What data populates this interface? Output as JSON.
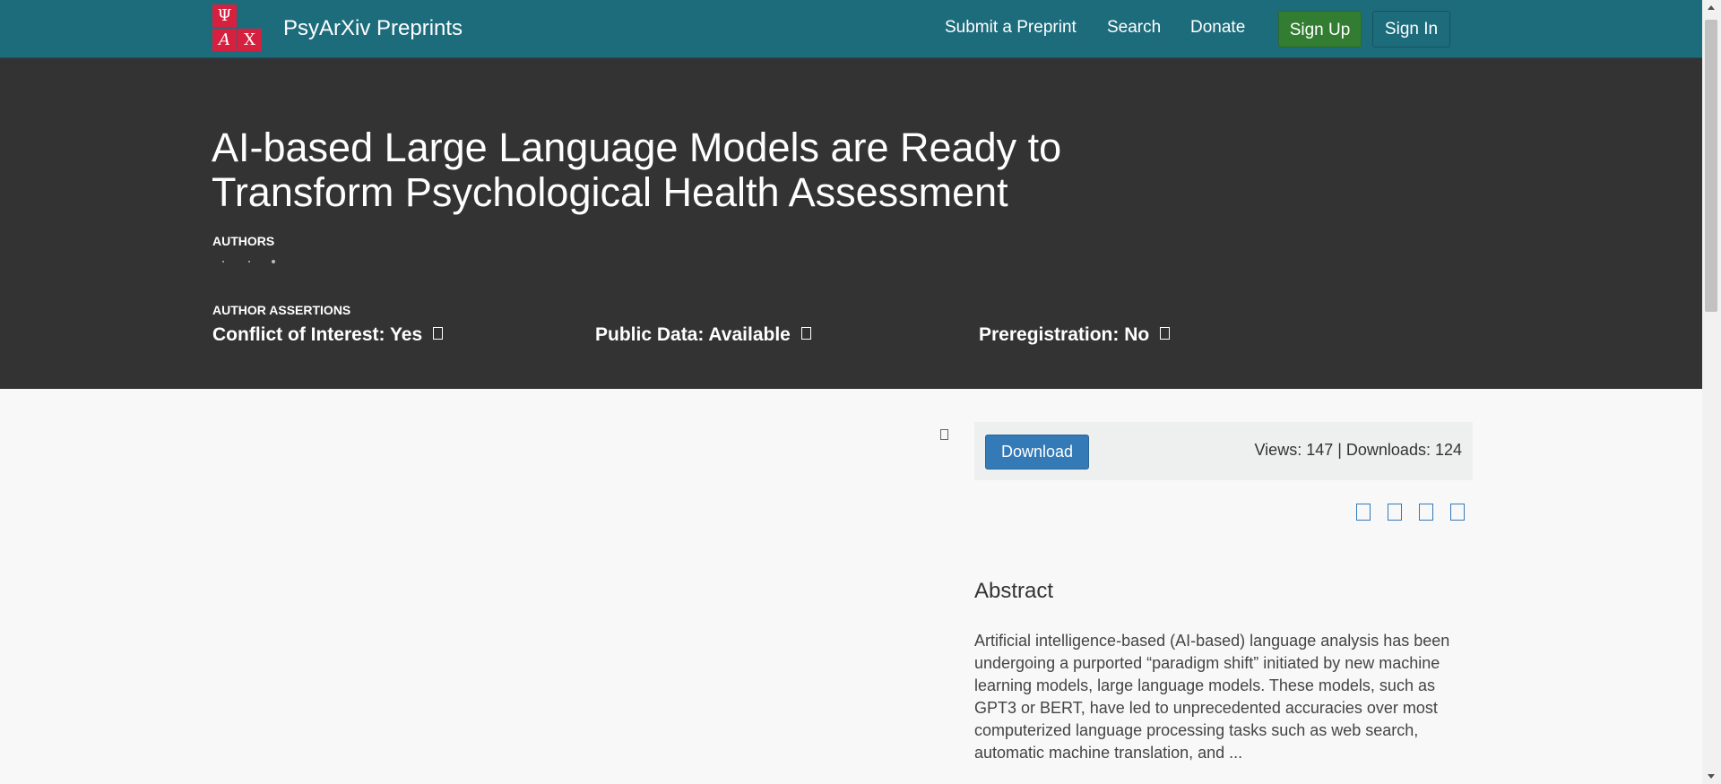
{
  "navbar": {
    "logo_letters": [
      "Ψ",
      "A",
      "X"
    ],
    "brand": "PsyArXiv Preprints",
    "links": [
      "Submit a Preprint",
      "Search",
      "Donate"
    ],
    "sign_up": "Sign Up",
    "sign_in": "Sign In"
  },
  "header": {
    "title": "AI-based Large Language Models are Ready to Transform Psychological Health Assessment",
    "authors_label": "AUTHORS",
    "assertions_label": "AUTHOR ASSERTIONS",
    "assertions": [
      {
        "label": "Conflict of Interest: Yes",
        "icon": "info-icon"
      },
      {
        "label": "Public Data: Available",
        "icon": "info-icon"
      },
      {
        "label": "Preregistration: No",
        "icon": "info-icon"
      }
    ]
  },
  "main": {
    "download_label": "Download",
    "stats": "Views: 147 | Downloads: 124",
    "share_icons": [
      "twitter-icon",
      "facebook-icon",
      "linkedin-icon",
      "email-icon"
    ],
    "abstract_title": "Abstract",
    "abstract_text": "Artificial intelligence-based (AI-based) language analysis has been undergoing a purported “paradigm shift” initiated by new machine learning models, large language models. These models, such as GPT3 or BERT, have led to unprecedented accuracies over most computerized language processing tasks such as web search, automatic machine translation, and ..."
  },
  "colors": {
    "navbar": "#1d6c7c",
    "header": "#333333",
    "logo": "#d6203f",
    "sign_up": "#337d33",
    "download": "#337ab7"
  }
}
